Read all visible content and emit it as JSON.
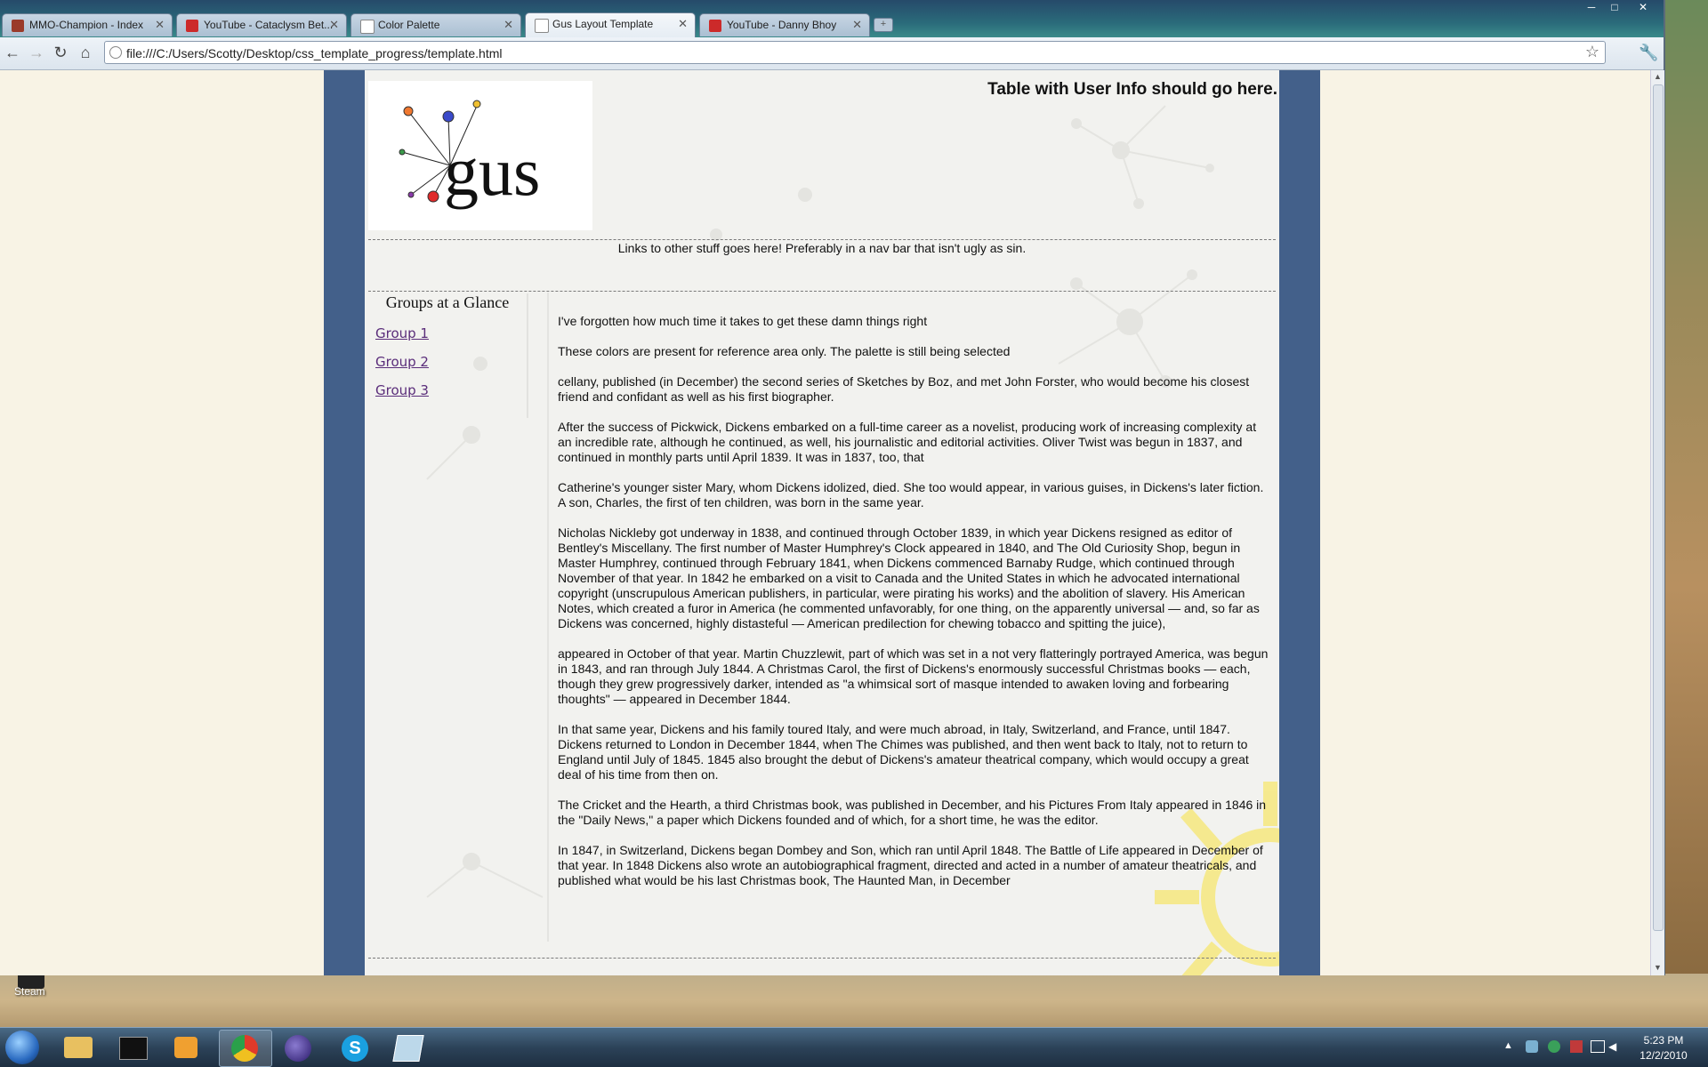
{
  "browser": {
    "tabs": [
      {
        "label": "MMO-Champion - Index",
        "icon": "mmo-favicon-icon",
        "active": false
      },
      {
        "label": "YouTube - Cataclysm Bet...",
        "icon": "youtube-favicon-icon",
        "active": false
      },
      {
        "label": "Color Palette",
        "icon": "page-favicon-icon",
        "active": false
      },
      {
        "label": "Gus Layout Template",
        "icon": "page-favicon-icon",
        "active": true
      },
      {
        "label": "YouTube - Danny Bhoy",
        "icon": "youtube-favicon-icon",
        "active": false
      }
    ],
    "address": "file:///C:/Users/Scotty/Desktop/css_template_progress/template.html"
  },
  "page": {
    "logo_text": "gus",
    "userinfo": "Table with User Info should go here.",
    "nav_text": "Links to other stuff goes here! Preferably in a nav bar that isn't ugly as sin.",
    "sidebar": {
      "title": "Groups at a Glance",
      "links": [
        "Group 1",
        "Group 2",
        "Group 3"
      ]
    },
    "paragraphs": [
      "I've forgotten how much time it takes to get these damn things right",
      "These colors are present for reference area only. The palette is still being selected",
      "cellany, published (in December) the second series of Sketches by Boz, and met John Forster, who would become his closest friend and confidant as well as his first biographer.",
      "After the success of Pickwick, Dickens embarked on a full-time career as a novelist, producing work of increasing complexity at an incredible rate, although he continued, as well, his journalistic and editorial activities. Oliver Twist was begun in 1837, and continued in monthly parts until April 1839. It was in 1837, too, that",
      "Catherine's younger sister Mary, whom Dickens idolized, died. She too would appear, in various guises, in Dickens's later fiction. A son, Charles, the first of ten children, was born in the same year.",
      "Nicholas Nickleby got underway in 1838, and continued through October 1839, in which year Dickens resigned as editor of Bentley's Miscellany. The first number of Master Humphrey's Clock appeared in 1840, and The Old Curiosity Shop, begun in Master Humphrey, continued through February 1841, when Dickens commenced Barnaby Rudge, which continued through November of that year. In 1842 he embarked on a visit to Canada and the United States in which he advocated international copyright (unscrupulous American publishers, in particular, were pirating his works) and the abolition of slavery. His American Notes, which created a furor in America (he commented unfavorably, for one thing, on the apparently universal — and, so far as Dickens was concerned, highly distasteful — American predilection for chewing tobacco and spitting the juice),",
      "appeared in October of that year. Martin Chuzzlewit, part of which was set in a not very flatteringly portrayed America, was begun in 1843, and ran through July 1844. A Christmas Carol, the first of Dickens's enormously successful Christmas books — each, though they grew progressively darker, intended as \"a whimsical sort of masque intended to awaken loving and forbearing thoughts\" — appeared in December 1844.",
      "In that same year, Dickens and his family toured Italy, and were much abroad, in Italy, Switzerland, and France, until 1847. Dickens returned to London in December 1844, when The Chimes was published, and then went back to Italy, not to return to England until July of 1845. 1845 also brought the debut of Dickens's amateur theatrical company, which would occupy a great deal of his time from then on.",
      "The Cricket and the Hearth, a third Christmas book, was published in December, and his Pictures From Italy appeared in 1846 in the \"Daily News,\" a paper which Dickens founded and of which, for a short time, he was the editor.",
      "In 1847, in Switzerland, Dickens began Dombey and Son, which ran until April 1848. The Battle of Life appeared in December of that year. In 1848 Dickens also wrote an autobiographical fragment, directed and acted in a number of amateur theatricals, and published what would be his last Christmas book, The Haunted Man, in December"
    ]
  },
  "desktop": {
    "icons": [
      {
        "label": "Steam",
        "icon": "steam-icon"
      }
    ]
  },
  "taskbar": {
    "apps": [
      "start-orb-icon",
      "explorer-icon",
      "terminal-icon",
      "media-player-icon",
      "chrome-icon",
      "eclipse-icon",
      "skype-icon",
      "notepad-icon"
    ],
    "time": "5:23 PM",
    "date": "12/2/2010"
  },
  "colors": {
    "page_frame": "#43608a",
    "content_bg": "#f2f2ef",
    "link": "#5a2d7a",
    "decoration_yellow": "#f6e98a"
  }
}
